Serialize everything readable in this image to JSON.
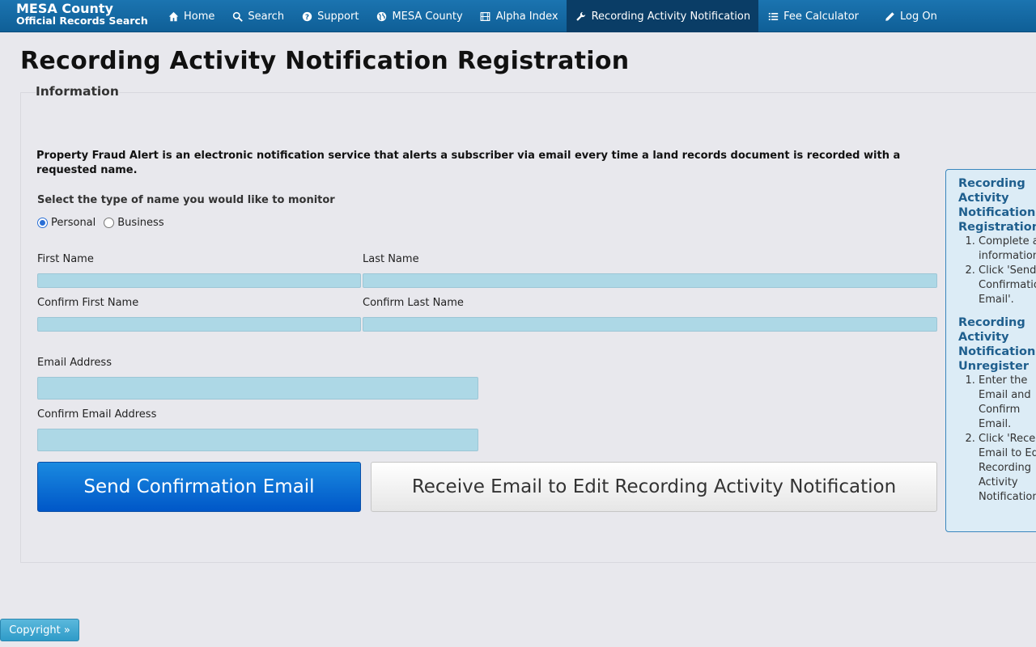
{
  "brand": {
    "line1": "MESA County",
    "line2": "Official Records Search"
  },
  "nav": [
    {
      "label": "Home",
      "icon": "home-icon"
    },
    {
      "label": "Search",
      "icon": "search-icon"
    },
    {
      "label": "Support",
      "icon": "question-icon"
    },
    {
      "label": "MESA County",
      "icon": "globe-icon"
    },
    {
      "label": "Alpha Index",
      "icon": "film-icon"
    },
    {
      "label": "Recording Activity Notification",
      "icon": "wrench-icon",
      "active": true
    },
    {
      "label": "Fee Calculator",
      "icon": "list-icon"
    },
    {
      "label": "Log On",
      "icon": "pencil-icon"
    }
  ],
  "page": {
    "title": "Recording Activity Notification Registration",
    "legend": "Information",
    "intro": "Property Fraud Alert is an electronic notification service that alerts a subscriber via email every time a land records document is recorded with a requested name.",
    "select_label": "Select the type of name you would like to monitor",
    "radio_personal": "Personal",
    "radio_business": "Business",
    "radio_selected": "Personal"
  },
  "form": {
    "first_name_label": "First Name",
    "last_name_label": "Last Name",
    "confirm_first_name_label": "Confirm First Name",
    "confirm_last_name_label": "Confirm Last Name",
    "email_label": "Email Address",
    "confirm_email_label": "Confirm Email Address",
    "first_name": "",
    "last_name": "",
    "confirm_first_name": "",
    "confirm_last_name": "",
    "email": "",
    "confirm_email": ""
  },
  "buttons": {
    "send": "Send Confirmation Email",
    "receive": "Receive Email to Edit Recording Activity Notification"
  },
  "side": {
    "register_heading": "Recording Activity Notification Registration",
    "register_steps": [
      "Complete all information",
      "Click 'Send Confirmation Email'."
    ],
    "unregister_heading": "Recording Activity Notification Unregister",
    "unregister_steps": [
      "Enter the Email and Confirm Email.",
      "Click 'Receive Email to Edit Recording Activity Notification'."
    ]
  },
  "footer": {
    "copyright": "Copyright »"
  },
  "colors": {
    "nav_bg": "#1b74b0",
    "nav_active": "#0a3d66",
    "input_bg": "#add8e6",
    "primary": "#0057c8",
    "panel_border": "#3a86bd"
  }
}
